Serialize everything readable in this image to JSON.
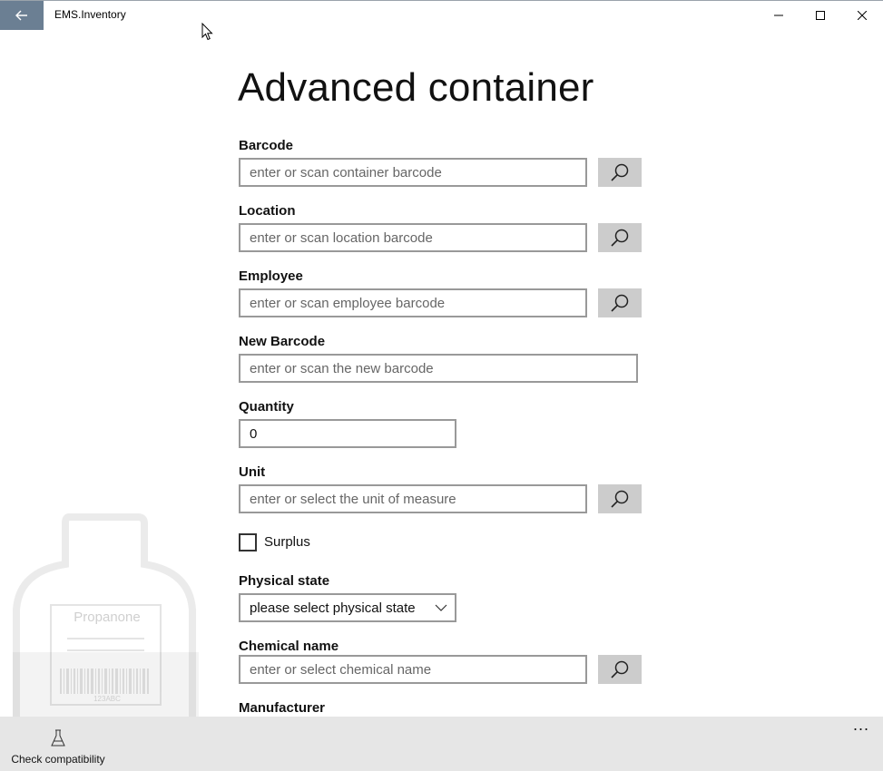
{
  "window": {
    "title": "EMS.Inventory"
  },
  "page": {
    "title": "Advanced container"
  },
  "form": {
    "barcode": {
      "label": "Barcode",
      "placeholder": "enter or scan container barcode"
    },
    "location": {
      "label": "Location",
      "placeholder": "enter or scan location barcode"
    },
    "employee": {
      "label": "Employee",
      "placeholder": "enter or scan employee barcode"
    },
    "new_barcode": {
      "label": "New Barcode",
      "placeholder": "enter or scan the new barcode"
    },
    "quantity": {
      "label": "Quantity",
      "value": "0"
    },
    "unit": {
      "label": "Unit",
      "placeholder": "enter or select the unit of measure"
    },
    "surplus": {
      "label": "Surplus",
      "checked": false
    },
    "physical_state": {
      "label": "Physical state",
      "selected": "please select physical state"
    },
    "chemical_name": {
      "label": "Chemical name",
      "placeholder": "enter or select chemical name"
    },
    "manufacturer": {
      "label": "Manufacturer"
    }
  },
  "watermark": {
    "label_text": "Propanone",
    "barcode_text": "123ABC"
  },
  "commandbar": {
    "check_compat_label": "Check compatibility",
    "more_label": "..."
  },
  "icons": {
    "back": "back-arrow-icon",
    "search": "magnifier-icon",
    "flask": "flask-icon",
    "chevron": "chevron-down-icon"
  },
  "colors": {
    "back_button": "#6b7f93",
    "command_bar": "#e6e6e6",
    "search_button": "#cccccc"
  }
}
